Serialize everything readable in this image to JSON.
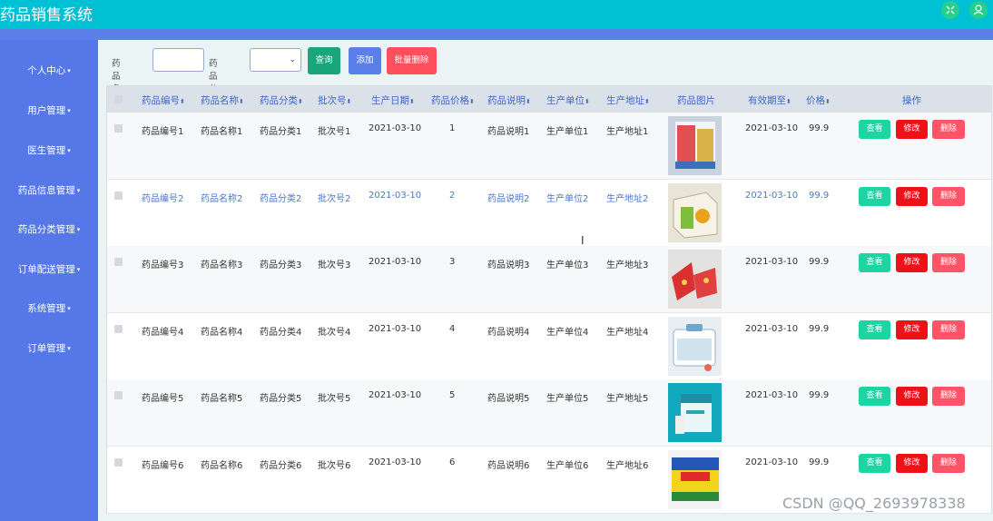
{
  "app": {
    "title": "药品销售系统"
  },
  "topbar": {
    "icons": [
      "fullscreen-icon",
      "user-icon"
    ]
  },
  "colors": {
    "topbar": "#00c0d4",
    "sidebar": "#5577e8",
    "query": "#1aa67a",
    "add": "#5b7fe8",
    "batch_delete": "#ff4e5c",
    "view": "#1dd4a3",
    "edit": "#ef1118",
    "delete": "#ff5468"
  },
  "sidebar": {
    "items": [
      {
        "label": "个人中心"
      },
      {
        "label": "用户管理"
      },
      {
        "label": "医生管理"
      },
      {
        "label": "药品信息管理"
      },
      {
        "label": "药品分类管理"
      },
      {
        "label": "订单配送管理"
      },
      {
        "label": "系统管理"
      },
      {
        "label": "订单管理"
      }
    ]
  },
  "toolbar": {
    "name_label": "药品名称",
    "name_value": "",
    "category_label": "药品分类",
    "category_value": "",
    "query_label": "查询",
    "add_label": "添加",
    "batch_delete_label": "批量删除"
  },
  "table": {
    "columns": [
      "药品编号",
      "药品名称",
      "药品分类",
      "批次号",
      "生产日期",
      "药品价格",
      "药品说明",
      "生产单位",
      "生产地址",
      "药品图片",
      "有效期至",
      "价格",
      "操作"
    ],
    "sortable": [
      true,
      true,
      true,
      true,
      true,
      true,
      true,
      true,
      true,
      false,
      true,
      true,
      false
    ],
    "actions": {
      "view": "查看",
      "edit": "修改",
      "delete": "删除"
    },
    "rows": [
      {
        "code": "药品编号1",
        "name": "药品名称1",
        "category": "药品分类1",
        "batch": "批次号1",
        "date": "2021-03-10",
        "drug_price": "1",
        "desc": "药品说明1",
        "unit": "生产单位1",
        "address": "生产地址1",
        "expiry": "2021-03-10",
        "price": "99.9"
      },
      {
        "code": "药品编号2",
        "name": "药品名称2",
        "category": "药品分类2",
        "batch": "批次号2",
        "date": "2021-03-10",
        "drug_price": "2",
        "desc": "药品说明2",
        "unit": "生产单位2",
        "address": "生产地址2",
        "expiry": "2021-03-10",
        "price": "99.9"
      },
      {
        "code": "药品编号3",
        "name": "药品名称3",
        "category": "药品分类3",
        "batch": "批次号3",
        "date": "2021-03-10",
        "drug_price": "3",
        "desc": "药品说明3",
        "unit": "生产单位3",
        "address": "生产地址3",
        "expiry": "2021-03-10",
        "price": "99.9"
      },
      {
        "code": "药品编号4",
        "name": "药品名称4",
        "category": "药品分类4",
        "batch": "批次号4",
        "date": "2021-03-10",
        "drug_price": "4",
        "desc": "药品说明4",
        "unit": "生产单位4",
        "address": "生产地址4",
        "expiry": "2021-03-10",
        "price": "99.9"
      },
      {
        "code": "药品编号5",
        "name": "药品名称5",
        "category": "药品分类5",
        "batch": "批次号5",
        "date": "2021-03-10",
        "drug_price": "5",
        "desc": "药品说明5",
        "unit": "生产单位5",
        "address": "生产地址5",
        "expiry": "2021-03-10",
        "price": "99.9"
      },
      {
        "code": "药品编号6",
        "name": "药品名称6",
        "category": "药品分类6",
        "batch": "批次号6",
        "date": "2021-03-10",
        "drug_price": "6",
        "desc": "药品说明6",
        "unit": "生产单位6",
        "address": "生产地址6",
        "expiry": "2021-03-10",
        "price": "99.9"
      }
    ]
  },
  "watermark": {
    "text": "CSDN @QQ_2693978338"
  }
}
